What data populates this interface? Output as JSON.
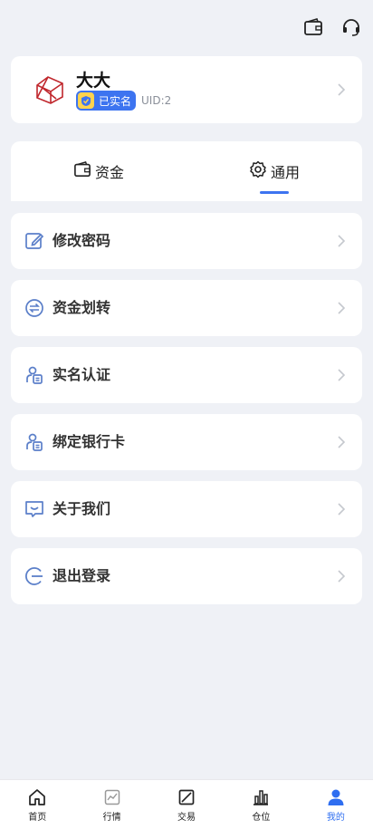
{
  "header": {
    "wallet_icon": "wallet-icon",
    "support_icon": "headset-icon"
  },
  "profile": {
    "name": "大大",
    "verified_label": "已实名",
    "uid": "UID:2"
  },
  "tabs": [
    {
      "label": "资金",
      "icon": "wallet-icon"
    },
    {
      "label": "通用",
      "icon": "gear-icon",
      "active": true
    }
  ],
  "menu": [
    {
      "label": "修改密码",
      "icon": "edit-icon"
    },
    {
      "label": "资金划转",
      "icon": "transfer-icon"
    },
    {
      "label": "实名认证",
      "icon": "id-card-icon"
    },
    {
      "label": "绑定银行卡",
      "icon": "bank-card-icon"
    },
    {
      "label": "关于我们",
      "icon": "message-icon"
    },
    {
      "label": "退出登录",
      "icon": "logout-icon"
    }
  ],
  "nav": [
    {
      "label": "首页",
      "icon": "home-icon"
    },
    {
      "label": "行情",
      "icon": "market-icon"
    },
    {
      "label": "交易",
      "icon": "trade-icon"
    },
    {
      "label": "仓位",
      "icon": "position-icon"
    },
    {
      "label": "我的",
      "icon": "user-icon",
      "active": true
    }
  ],
  "colors": {
    "accent": "#3d74f0",
    "background": "#eff1f6",
    "nav_active": "#2f6ef0"
  }
}
